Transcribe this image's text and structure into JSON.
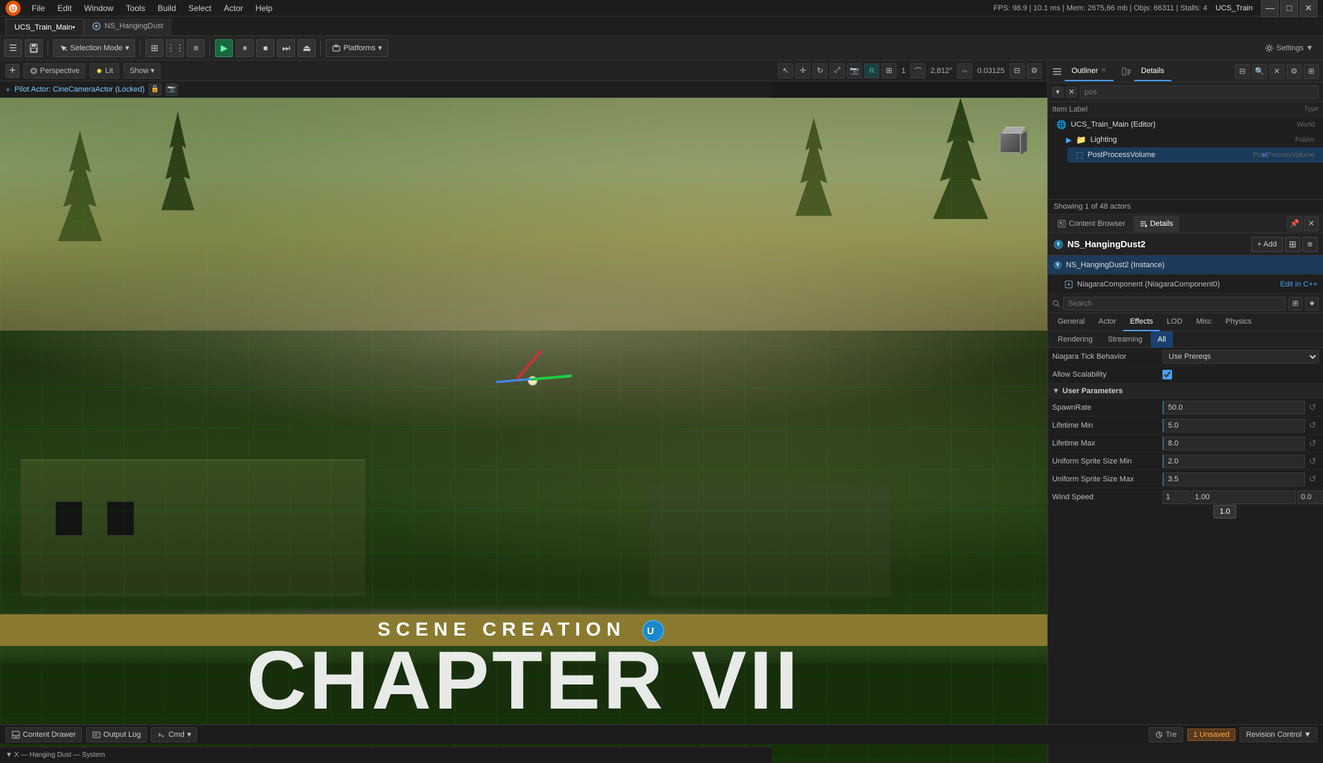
{
  "menubar": {
    "file": "File",
    "edit": "Edit",
    "window": "Window",
    "tools": "Tools",
    "build": "Build",
    "select": "Select",
    "actor": "Actor",
    "help": "Help",
    "fps_label": "FPS:",
    "fps_value": "98.9",
    "ms_label": "10.1 ms",
    "mem_label": "Mem: 2675,66 mb",
    "objs_label": "Objs: 66311",
    "stalls_label": "Stalls: 4",
    "project_name": "UCS_Train",
    "tab1": "UCS_Train_Main•",
    "tab2": "NS_HangingDust"
  },
  "toolbar": {
    "selection_mode": "Selection Mode",
    "platforms": "Platforms",
    "settings": "Settings ▼"
  },
  "viewport": {
    "perspective": "Perspective",
    "lit": "Lit",
    "show": "Show",
    "angle": "2,812°",
    "scale": "0.03125",
    "grid": "1",
    "pilot_label": "Pilot Actor: CineCameraActor (Locked)"
  },
  "chapter": {
    "title": "CHAPTER VII",
    "subtitle": "SCENE CREATION"
  },
  "outliner": {
    "tab_label": "Outliner",
    "details_tab_label": "Details",
    "search_placeholder": "pos",
    "item_label_col": "Item Label",
    "type_col": "Type",
    "rows": [
      {
        "name": "UCS_Train_Main (Editor)",
        "type": "World",
        "indent": 0
      },
      {
        "name": "Lighting",
        "type": "Folder",
        "indent": 1
      },
      {
        "name": "PostProcessVolume",
        "type": "PostProcessVolume",
        "indent": 2
      }
    ],
    "showing": "Showing 1 of 48 actors"
  },
  "details": {
    "content_browser_label": "Content Browser",
    "details_label": "Details",
    "close_icon": "✕",
    "actor_name": "NS_HangingDust2",
    "add_label": "+ Add",
    "instance_name": "NS_HangingDust2 (Instance)",
    "component_name": "NiagaraComponent (NiagaraComponent0)",
    "edit_cpp_label": "Edit in C++",
    "search_placeholder": "Search",
    "categories": {
      "general": "General",
      "actor": "Actor",
      "effects": "Effects",
      "lod": "LOD",
      "misc": "Misc",
      "physics": "Physics"
    },
    "subtabs": {
      "rendering": "Rendering",
      "streaming": "Streaming",
      "all": "All"
    },
    "properties": {
      "section_label": "User Parameters",
      "niagara_tick": {
        "label": "Niagara Tick Behavior",
        "value": "Use Prereqs"
      },
      "allow_scalability": {
        "label": "Allow Scalability",
        "checked": true
      },
      "spawn_rate": {
        "label": "SpawnRate",
        "value": "50.0"
      },
      "lifetime_min": {
        "label": "Lifetime Min",
        "value": "5.0"
      },
      "lifetime_max": {
        "label": "Lifetime Max",
        "value": "8.0"
      },
      "sprite_size_min": {
        "label": "Uniform Sprite Size Min",
        "value": "2.0"
      },
      "sprite_size_max": {
        "label": "Uniform Sprite Size Max",
        "value": "3.5"
      },
      "wind_speed": {
        "label": "Wind Speed",
        "v1": "1",
        "v2": "1.00",
        "v3": "0.0"
      }
    }
  },
  "tooltip": {
    "value": "1.0",
    "visible": true
  },
  "bottombar": {
    "content_drawer": "Content Drawer",
    "output_log": "Output Log",
    "cmd": "Cmd",
    "unsaved": "1 Unsaved",
    "revision": "Revision Control ▼"
  },
  "statusbar": {
    "info": "▼ X — Hanging Dust — System"
  }
}
